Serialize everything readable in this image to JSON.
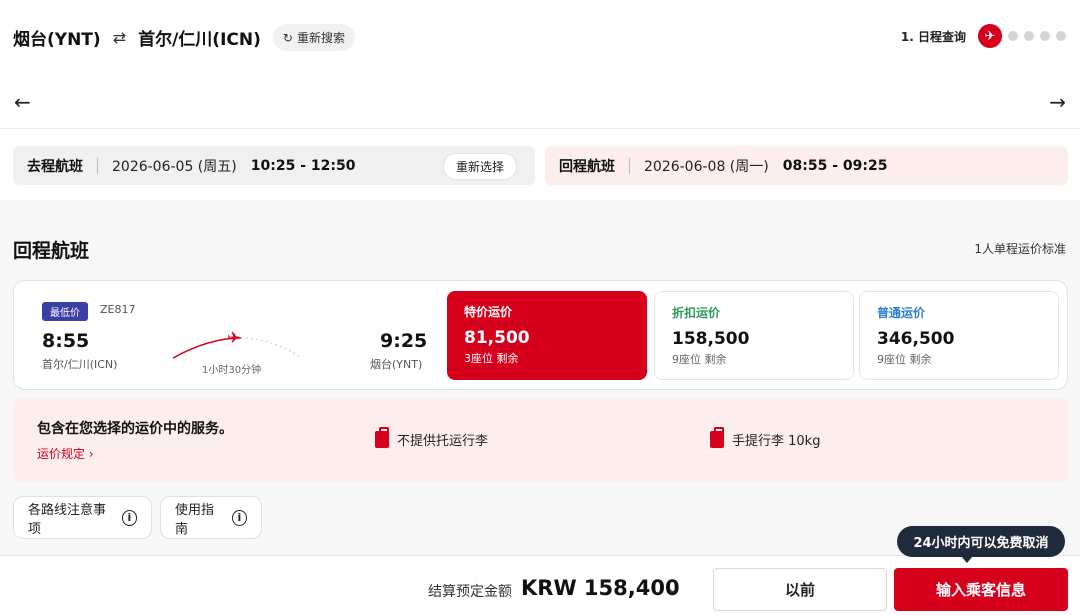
{
  "header": {
    "origin": "烟台(YNT)",
    "swap_symbol": "⇄",
    "destination": "首尔/仁川(ICN)",
    "research_label": "重新搜索",
    "step_label": "1. 日程查询"
  },
  "summary": {
    "outbound": {
      "title": "去程航班",
      "date": "2026-06-05 (周五)",
      "time": "10:25 - 12:50",
      "reselect_label": "重新选择"
    },
    "return": {
      "title": "回程航班",
      "date": "2026-06-08 (周一)",
      "time": "08:55 - 09:25"
    }
  },
  "section": {
    "title": "回程航班",
    "fare_standard": "1人单程运价标准"
  },
  "flight": {
    "badge": "最低价",
    "flight_no": "ZE817",
    "dep_time": "8:55",
    "dep_airport": "首尔/仁川(ICN)",
    "arr_time": "9:25",
    "arr_airport": "烟台(YNT)",
    "duration": "1小时30分钟"
  },
  "fares": [
    {
      "name": "特价运价",
      "price": "81,500",
      "seats": "3座位 剩余"
    },
    {
      "name": "折扣运价",
      "price": "158,500",
      "seats": "9座位 剩余"
    },
    {
      "name": "普通运价",
      "price": "346,500",
      "seats": "9座位 剩余"
    }
  ],
  "services": {
    "title": "包含在您选择的运价中的服务。",
    "rules_link": "运价规定 ›",
    "items": [
      "不提供托运行李",
      "手提行李 10kg"
    ]
  },
  "links": {
    "route_notes": "各路线注意事项",
    "guide": "使用指南"
  },
  "footer": {
    "total_label": "结算预定金额",
    "total_value": "KRW 158,400",
    "prev_label": "以前",
    "next_label": "输入乘客信息",
    "tooltip": "24小时内可以免费取消"
  },
  "colors": {
    "brand_red": "#d6001c",
    "lowest_badge": "#3a3fa6",
    "discount_green": "#2e9b5c",
    "normal_blue": "#2f7fd0"
  }
}
